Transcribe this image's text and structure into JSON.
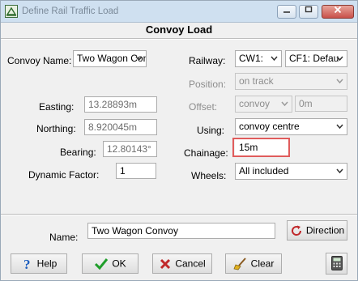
{
  "window": {
    "title": "Define Rail Traffic Load"
  },
  "header": {
    "title": "Convoy Load"
  },
  "left": {
    "convoy_name_label": "Convoy Name:",
    "convoy_name_value": "Two Wagon Con",
    "easting_label": "Easting:",
    "easting_value": "13.28893m",
    "northing_label": "Northing:",
    "northing_value": "8.920045m",
    "bearing_label": "Bearing:",
    "bearing_value": "12.80143°",
    "dynamic_factor_label": "Dynamic Factor:",
    "dynamic_factor_value": "1"
  },
  "right": {
    "railway_label": "Railway:",
    "railway_value_1": "CW1:",
    "railway_value_2": "CF1: Defau",
    "position_label": "Position:",
    "position_value": "on track",
    "offset_label": "Offset:",
    "offset_combo_value": "convoy",
    "offset_value": "0m",
    "using_label": "Using:",
    "using_value": "convoy centre",
    "chainage_label": "Chainage:",
    "chainage_value": "15m",
    "wheels_label": "Wheels:",
    "wheels_value": "All included"
  },
  "name_row": {
    "name_label": "Name:",
    "name_value": "Two Wagon Convoy",
    "direction_button": "Direction"
  },
  "buttons": {
    "help": "Help",
    "ok": "OK",
    "cancel": "Cancel",
    "clear": "Clear"
  },
  "colors": {
    "highlight": "#e05c5c",
    "ok_check": "#1f9e2a",
    "cancel_x": "#c0282a",
    "help_icon": "#1f5fbf"
  }
}
